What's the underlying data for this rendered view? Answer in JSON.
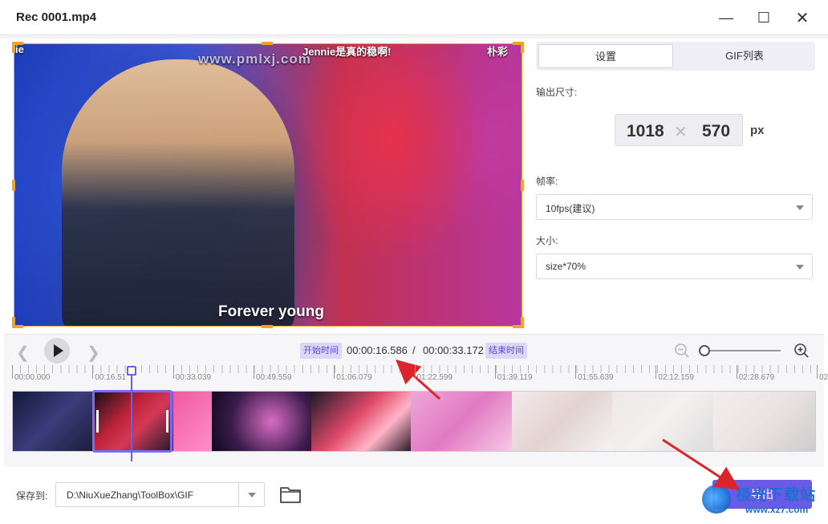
{
  "window": {
    "title": "Rec 0001.mp4",
    "minimize": "—",
    "maximize": "☐",
    "close": "✕"
  },
  "preview": {
    "overlay_left": "ie",
    "watermark": "www.pmlxj.com",
    "overlay_caption": "Jennie是真的稳啊!",
    "overlay_right": "朴彩",
    "subtitle": "Forever young"
  },
  "tabs": [
    {
      "label": "设置",
      "active": true
    },
    {
      "label": "GIF列表",
      "active": false
    }
  ],
  "settings": {
    "output_size_label": "输出尺寸:",
    "width": "1018",
    "times": "✕",
    "height": "570",
    "unit": "px",
    "fps_label": "帧率:",
    "fps_value": "10fps(建议)",
    "size_label": "大小:",
    "size_value": "size*70%"
  },
  "controls": {
    "prev_icon": "chevron-left-icon",
    "next_icon": "chevron-right-icon",
    "start_tag": "开始时间",
    "start_time": "00:00:16.586",
    "separator": "/",
    "end_time": "00:00:33.172",
    "end_tag": "结束时间",
    "zoom": 0.0
  },
  "timeline": {
    "ticks": [
      "00:00.000",
      "00:16.51",
      "00:33.039",
      "00:49.559",
      "01:06.079",
      "01:22.599",
      "01:39.119",
      "01:55.639",
      "02:12.159",
      "02:28.679",
      "02"
    ]
  },
  "footer": {
    "save_to_label": "保存到:",
    "path": "D:\\NiuXueZhang\\ToolBox\\GIF",
    "export_label": "导出"
  },
  "watermark_logo": {
    "text1": "极光下载站",
    "text2": "www.xz7.com"
  },
  "colors": {
    "accent": "#6a5ae6",
    "crop_frame": "#f0a32a",
    "arrow": "#d9252b"
  }
}
